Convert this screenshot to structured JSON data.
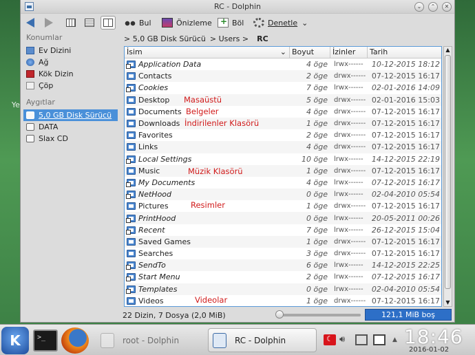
{
  "desktop": {
    "partial_label": "Yel"
  },
  "window": {
    "title": "RC - Dolphin"
  },
  "toolbar": {
    "find": "Bul",
    "preview": "Önizleme",
    "split": "Böl",
    "configure": "Denetle"
  },
  "sidebar": {
    "places_title": "Konumlar",
    "places": [
      "Ev Dizini",
      "Ağ",
      "Kök Dizin",
      "Çöp"
    ],
    "devices_title": "Aygıtlar",
    "devices": [
      "5,0 GB Disk Sürücü",
      "DATA",
      "Slax CD"
    ]
  },
  "breadcrumb": {
    "items": [
      "> 5,0 GB Disk Sürücü",
      "> Users >",
      "RC"
    ]
  },
  "columns": {
    "name": "İsim",
    "size": "Boyut",
    "perm": "İzinler",
    "date": "Tarih"
  },
  "files": [
    {
      "name": "Application Data",
      "size": "4 öge",
      "perm": "lrwx------",
      "date": "10-12-2015 18:12",
      "italic": true
    },
    {
      "name": "Contacts",
      "size": "2 öge",
      "perm": "drwx------",
      "date": "07-12-2015 16:17",
      "italic": false
    },
    {
      "name": "Cookies",
      "size": "7 öge",
      "perm": "lrwx------",
      "date": "02-01-2016 14:09",
      "italic": true
    },
    {
      "name": "Desktop",
      "size": "5 öge",
      "perm": "drwx------",
      "date": "02-01-2016 15:03",
      "italic": false
    },
    {
      "name": "Documents",
      "size": "4 öge",
      "perm": "drwx------",
      "date": "07-12-2015 16:17",
      "italic": false
    },
    {
      "name": "Downloads",
      "size": "1 öge",
      "perm": "drwx------",
      "date": "07-12-2015 16:17",
      "italic": false
    },
    {
      "name": "Favorites",
      "size": "2 öge",
      "perm": "drwx------",
      "date": "07-12-2015 16:17",
      "italic": false
    },
    {
      "name": "Links",
      "size": "4 öge",
      "perm": "drwx------",
      "date": "07-12-2015 16:17",
      "italic": false
    },
    {
      "name": "Local Settings",
      "size": "10 öge",
      "perm": "lrwx------",
      "date": "14-12-2015 22:19",
      "italic": true
    },
    {
      "name": "Music",
      "size": "1 öge",
      "perm": "drwx------",
      "date": "07-12-2015 16:17",
      "italic": false
    },
    {
      "name": "My Documents",
      "size": "4 öge",
      "perm": "lrwx------",
      "date": "07-12-2015 16:17",
      "italic": true
    },
    {
      "name": "NetHood",
      "size": "0 öge",
      "perm": "lrwx------",
      "date": "02-04-2010 05:54",
      "italic": true
    },
    {
      "name": "Pictures",
      "size": "1 öge",
      "perm": "drwx------",
      "date": "07-12-2015 16:17",
      "italic": false
    },
    {
      "name": "PrintHood",
      "size": "0 öge",
      "perm": "lrwx------",
      "date": "20-05-2011 00:26",
      "italic": true
    },
    {
      "name": "Recent",
      "size": "7 öge",
      "perm": "lrwx------",
      "date": "26-12-2015 15:04",
      "italic": true
    },
    {
      "name": "Saved Games",
      "size": "1 öge",
      "perm": "drwx------",
      "date": "07-12-2015 16:17",
      "italic": false
    },
    {
      "name": "Searches",
      "size": "3 öge",
      "perm": "drwx------",
      "date": "07-12-2015 16:17",
      "italic": false
    },
    {
      "name": "SendTo",
      "size": "6 öge",
      "perm": "lrwx------",
      "date": "14-12-2015 22:25",
      "italic": true
    },
    {
      "name": "Start Menu",
      "size": "2 öge",
      "perm": "lrwx------",
      "date": "07-12-2015 16:17",
      "italic": true
    },
    {
      "name": "Templates",
      "size": "0 öge",
      "perm": "lrwx------",
      "date": "02-04-2010 05:54",
      "italic": true
    },
    {
      "name": "Videos",
      "size": "1 öge",
      "perm": "drwx------",
      "date": "07-12-2015 16:17",
      "italic": false
    }
  ],
  "annotations": {
    "desktop": "Masaüstü",
    "documents": "Belgeler",
    "downloads": "İndirilenler Klasörü",
    "music": "Müzik Klasörü",
    "pictures": "Resimler",
    "videos": "Videolar"
  },
  "status": {
    "summary": "22 Dizin, 7 Dosya (2,0 MiB)",
    "free_space": "121,1 MiB boş",
    "zoom_fraction": 0.0
  },
  "taskbar": {
    "task_root": "root - Dolphin",
    "task_rc": "RC - Dolphin",
    "clock": "18:46",
    "date": "2016-01-02"
  },
  "colors": {
    "accent": "#4a90d9",
    "annotation": "#d11a1a",
    "free_bar": "#2d6fc7"
  }
}
